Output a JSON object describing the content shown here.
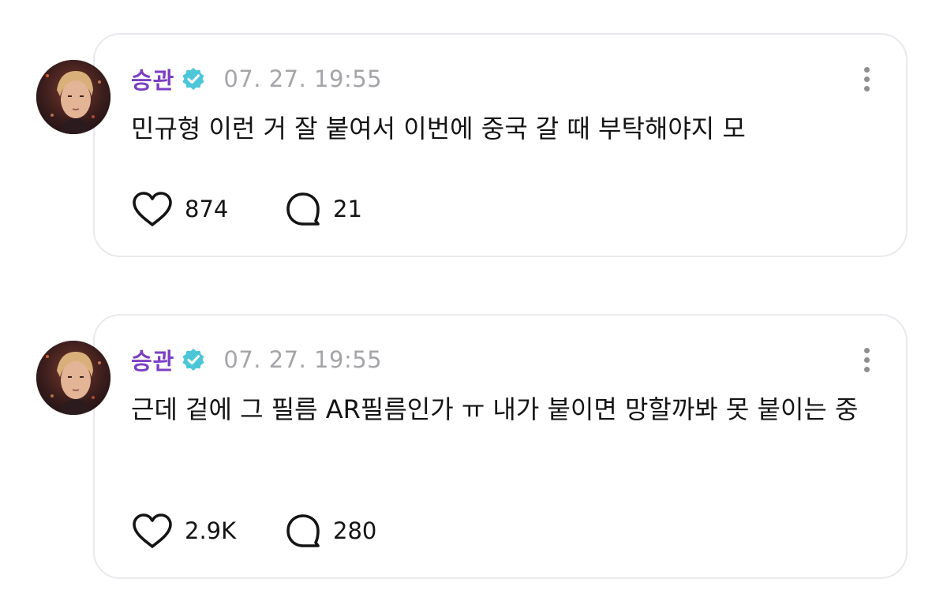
{
  "posts": [
    {
      "username": "승관",
      "timestamp": "07. 27. 19:55",
      "text": "민규형 이런 거 잘 붙여서 이번에 중국 갈 때 부탁해야지 모",
      "likes": "874",
      "comments": "21"
    },
    {
      "username": "승관",
      "timestamp": "07. 27. 19:55",
      "text": "근데 겉에 그 필름 AR필름인가 ㅠ 내가 붙이면 망할까봐 못 붙이는 중",
      "likes": "2.9K",
      "comments": "280"
    }
  ],
  "icons": {
    "verified": "verified-badge-icon",
    "like": "heart-icon",
    "comment": "comment-bubble-icon",
    "more": "more-vertical-icon"
  },
  "colors": {
    "username": "#7c3fc4",
    "verified": "#4cc6d9",
    "timestamp": "#a5a5a9",
    "card_border": "#e9e9ee"
  }
}
